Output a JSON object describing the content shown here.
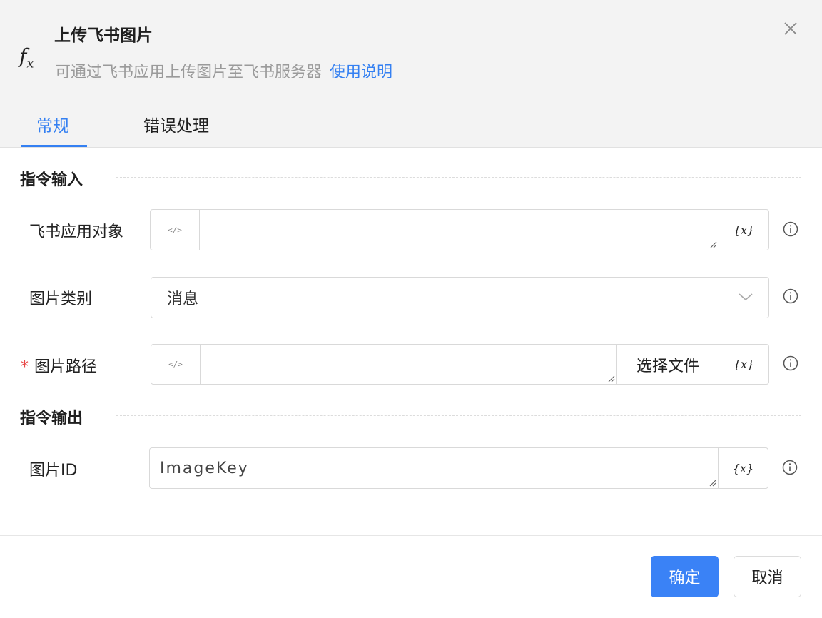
{
  "dialog": {
    "title": "上传飞书图片",
    "subtitle": "可通过飞书应用上传图片至飞书服务器",
    "help_link": "使用说明",
    "fx_icon": "fx-icon",
    "close_icon": "close-icon"
  },
  "tabs": [
    {
      "label": "常规",
      "active": true
    },
    {
      "label": "错误处理",
      "active": false
    }
  ],
  "sections": {
    "input_title": "指令输入",
    "output_title": "指令输出"
  },
  "fields": {
    "app_object": {
      "label": "飞书应用对象",
      "value": "",
      "code_icon": "</>",
      "var_icon": "{x}"
    },
    "image_type": {
      "label": "图片类别",
      "value": "消息"
    },
    "image_path": {
      "label": "图片路径",
      "required_mark": "*",
      "value": "",
      "code_icon": "</>",
      "file_button": "选择文件",
      "var_icon": "{x}"
    },
    "image_id": {
      "label": "图片ID",
      "value": "ImageKey",
      "var_icon": "{x}"
    }
  },
  "footer": {
    "ok_label": "确定",
    "cancel_label": "取消"
  },
  "colors": {
    "accent": "#3480f2",
    "required": "#e84545",
    "header_bg": "#f3f3f3"
  }
}
